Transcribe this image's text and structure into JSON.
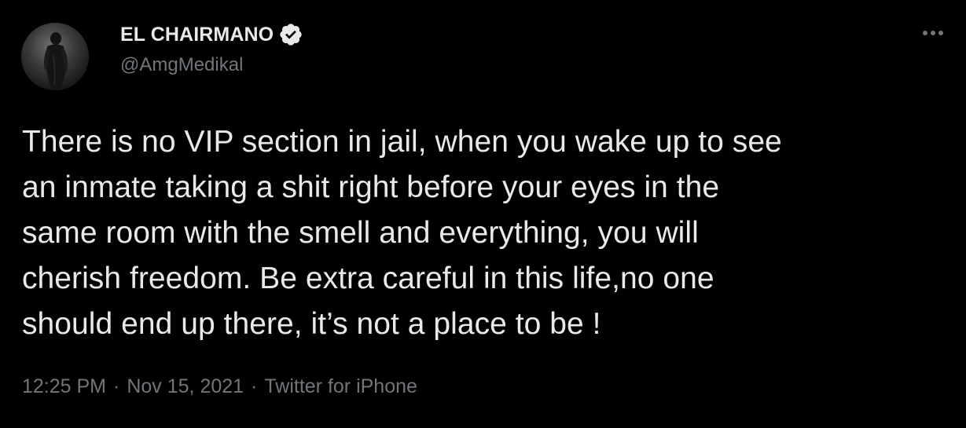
{
  "tweet": {
    "author": {
      "display_name": "EL CHAIRMANO",
      "handle": "@AmgMedikal",
      "verified": true
    },
    "text": "There is no VIP section in jail, when you wake up to see\nan inmate taking a shit right before your eyes in the\nsame room with the smell and everything, you will\ncherish freedom. Be extra careful in this life,no one\nshould end up there, it’s not a place to be !",
    "time": "12:25 PM",
    "date": "Nov 15, 2021",
    "source": "Twitter for iPhone",
    "separator": "·",
    "more_icon": "more-horizontal-icon"
  },
  "colors": {
    "background": "#000000",
    "primary_text": "#e7e9ea",
    "secondary_text": "#71767b"
  }
}
